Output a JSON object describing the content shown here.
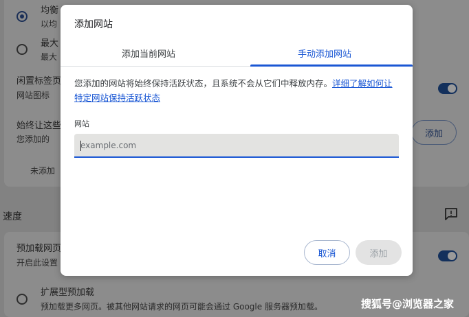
{
  "background": {
    "options": [
      {
        "label": "均衡",
        "desc": "以均",
        "selected": true
      },
      {
        "label": "最大",
        "desc": "最大",
        "selected": false
      }
    ],
    "inactive_tabs": {
      "title": "闲置标签页",
      "desc": "网站图标"
    },
    "always_active": {
      "title": "始终让这些",
      "desc": "您添加的",
      "empty": "未添加",
      "add_label": "添加"
    },
    "speed_section": "速度",
    "preload": {
      "title": "预加载网页",
      "desc": "开启此设置"
    },
    "extended_preload": {
      "title": "扩展型预加载",
      "desc": "预加载更多网页。被其他网站请求的网页可能会通过 Google 服务器预加载。"
    },
    "watermark": "搜狐号@浏览器之家"
  },
  "dialog": {
    "title": "添加网站",
    "tabs": [
      {
        "label": "添加当前网站",
        "active": false
      },
      {
        "label": "手动添加网站",
        "active": true
      }
    ],
    "description": "您添加的网站将始终保持活跃状态，且系统不会从它们中释放内存。",
    "learn_more": "详细了解如何让特定网站保持活跃状态",
    "field_label": "网站",
    "field_value": "",
    "field_placeholder": "example.com",
    "cancel_label": "取消",
    "add_label": "添加"
  },
  "colors": {
    "accent": "#1a57d4",
    "dim_background": "#828282",
    "disabled_button": "#e3e3e3"
  }
}
